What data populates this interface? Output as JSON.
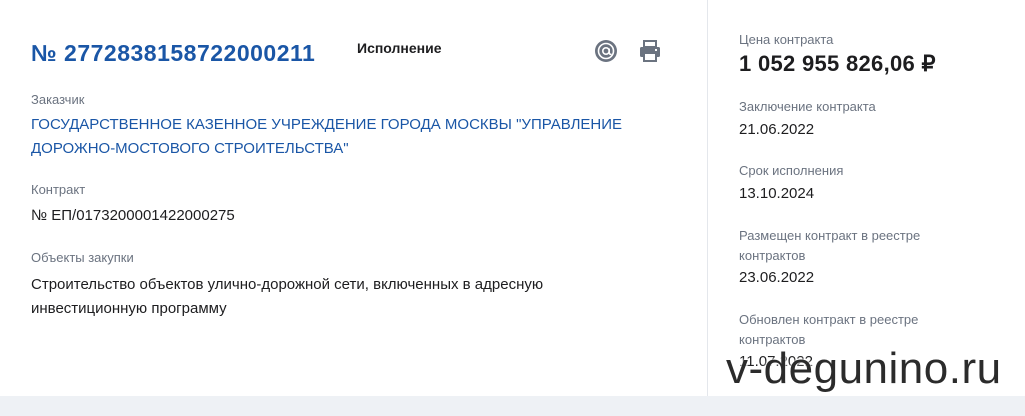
{
  "header": {
    "registry_number": "№ 2772838158722000211",
    "status": "Исполнение"
  },
  "icons": {
    "email": "at-sign-icon",
    "print": "printer-icon"
  },
  "customer": {
    "label": "Заказчик",
    "name_line1": "ГОСУДАРСТВЕННОЕ КАЗЕННОЕ УЧРЕЖДЕНИЕ ГОРОДА МОСКВЫ \"УПРАВЛЕНИЕ",
    "name_line2": "ДОРОЖНО-МОСТОВОГО СТРОИТЕЛЬСТВА\""
  },
  "contract": {
    "label": "Контракт",
    "number": "№ ЕП/0173200001422000275"
  },
  "objects": {
    "label": "Объекты закупки",
    "text_line1": "Строительство объектов улично-дорожной сети, включенных в адресную",
    "text_line2": "инвестиционную программу"
  },
  "sidebar": {
    "price_label": "Цена контракта",
    "price_value": "1 052 955 826,06 ₽",
    "conclusion_label": "Заключение контракта",
    "conclusion_date": "21.06.2022",
    "deadline_label": "Срок исполнения",
    "deadline_date": "13.10.2024",
    "placed_label_line1": "Размещен контракт в реестре",
    "placed_label_line2": "контрактов",
    "placed_date": "23.06.2022",
    "updated_label_line1": "Обновлен контракт в реестре",
    "updated_label_line2": "контрактов",
    "updated_date": "11.07.2022"
  },
  "watermark": "v-degunino.ru",
  "colors": {
    "link_blue": "#1a56a6",
    "label_gray": "#6b7380",
    "text_dark": "#1d1d1f"
  }
}
